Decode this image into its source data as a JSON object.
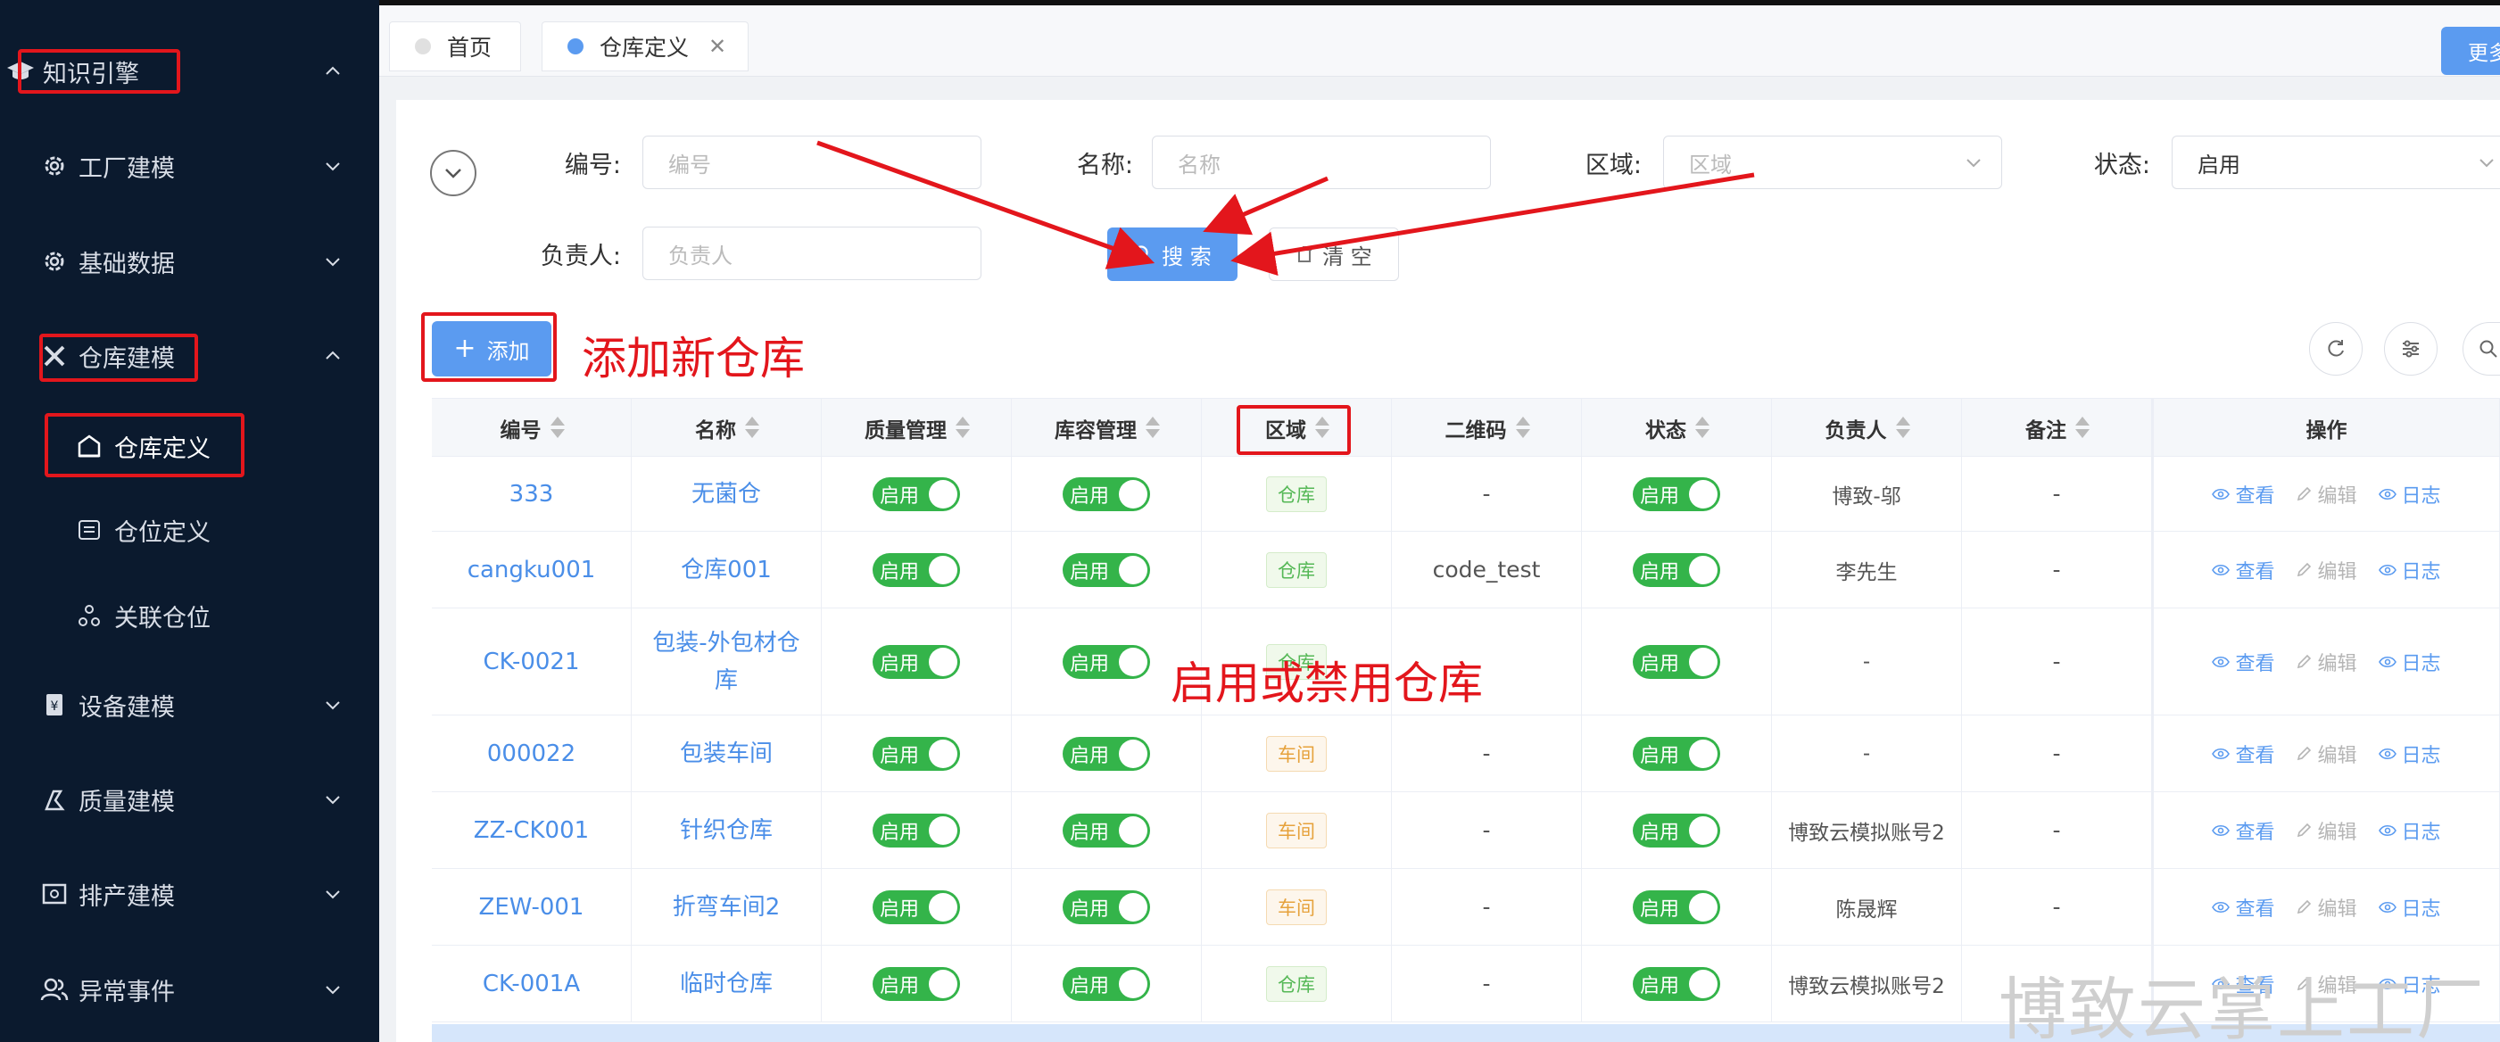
{
  "sidebar": {
    "items": [
      {
        "label": "知识引擎",
        "icon": "graduation-cap-icon",
        "expanded": true
      },
      {
        "label": "工厂建模",
        "icon": "gear-icon",
        "expanded": false
      },
      {
        "label": "基础数据",
        "icon": "gear-icon",
        "expanded": false
      },
      {
        "label": "仓库建模",
        "icon": "tools-icon",
        "expanded": true
      },
      {
        "label": "设备建模",
        "icon": "device-icon",
        "expanded": false
      },
      {
        "label": "质量建模",
        "icon": "quality-icon",
        "expanded": false
      },
      {
        "label": "排产建模",
        "icon": "schedule-icon",
        "expanded": false
      },
      {
        "label": "异常事件",
        "icon": "people-icon",
        "expanded": false
      }
    ],
    "subitems": [
      {
        "label": "仓库定义",
        "icon": "warehouse-icon",
        "active": true
      },
      {
        "label": "仓位定义",
        "icon": "storage-slot-icon",
        "active": false
      },
      {
        "label": "关联仓位",
        "icon": "link-nodes-icon",
        "active": false
      }
    ]
  },
  "tabs": [
    {
      "label": "首页",
      "closable": false
    },
    {
      "label": "仓库定义",
      "closable": true,
      "active": true
    }
  ],
  "more_button": "更多",
  "filters": {
    "code": {
      "label": "编号:",
      "placeholder": "编号"
    },
    "name": {
      "label": "名称:",
      "placeholder": "名称"
    },
    "area": {
      "label": "区域:",
      "placeholder": "区域"
    },
    "status": {
      "label": "状态:",
      "value": "启用"
    },
    "owner": {
      "label": "负责人:",
      "placeholder": "负责人"
    }
  },
  "buttons": {
    "search": "搜 索",
    "clear": "清 空",
    "add": "添加"
  },
  "annotations": {
    "add_new": "添加新仓库",
    "enable_disable": "启用或禁用仓库"
  },
  "table": {
    "columns": [
      "编号",
      "名称",
      "质量管理",
      "库容管理",
      "区域",
      "二维码",
      "状态",
      "负责人",
      "备注",
      "操作"
    ],
    "switch_label": "启用",
    "ops": {
      "view": "查看",
      "edit": "编辑",
      "log": "日志"
    },
    "rows": [
      {
        "code": "333",
        "name": "无菌仓",
        "area": "仓库",
        "area_color": "green",
        "qrcode": "-",
        "owner": "博致-邬",
        "remark": "-"
      },
      {
        "code": "cangku001",
        "name": "仓库001",
        "area": "仓库",
        "area_color": "green",
        "qrcode": "code_test",
        "owner": "李先生",
        "remark": "-"
      },
      {
        "code": "CK-0021",
        "name": "包装-外包材仓库",
        "area": "仓库",
        "area_color": "green",
        "qrcode": "",
        "owner": "-",
        "remark": "-"
      },
      {
        "code": "000022",
        "name": "包装车间",
        "area": "车间",
        "area_color": "orange",
        "qrcode": "-",
        "owner": "-",
        "remark": "-"
      },
      {
        "code": "ZZ-CK001",
        "name": "针织仓库",
        "area": "车间",
        "area_color": "orange",
        "qrcode": "-",
        "owner": "博致云模拟账号2",
        "remark": "-"
      },
      {
        "code": "ZEW-001",
        "name": "折弯车间2",
        "area": "车间",
        "area_color": "orange",
        "qrcode": "-",
        "owner": "陈晟辉",
        "remark": "-"
      },
      {
        "code": "CK-001A",
        "name": "临时仓库",
        "area": "仓库",
        "area_color": "green",
        "qrcode": "-",
        "owner": "博致云模拟账号2",
        "remark": "-"
      }
    ]
  },
  "watermark": "博致云掌上工厂",
  "colors": {
    "sidebar_bg": "#0b1a2e",
    "primary": "#5b9bf0",
    "switch_on": "#34b44a",
    "annotation": "#e3161c"
  }
}
